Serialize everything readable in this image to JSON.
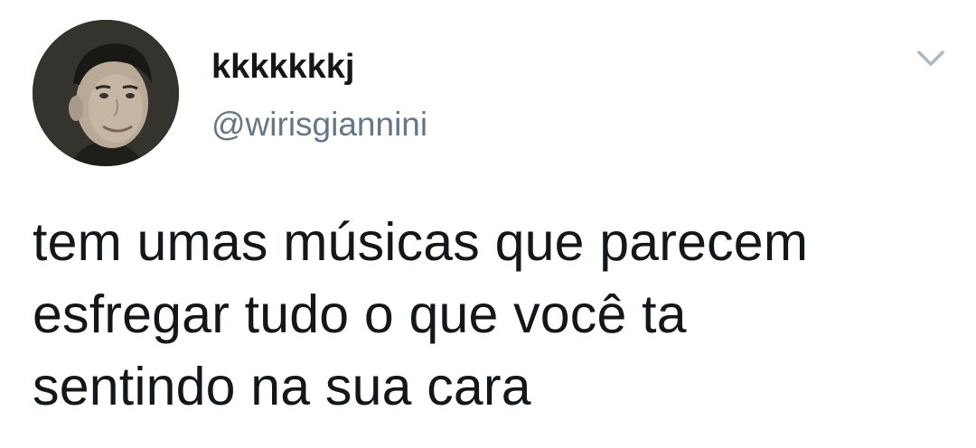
{
  "tweet": {
    "author": {
      "display_name": "kkkkkkkj",
      "handle": "@wirisgiannini",
      "avatar_icon": "profile-photo"
    },
    "menu_icon": "chevron-down-icon",
    "text_lines": [
      "tem umas músicas que parecem",
      "esfregar tudo o que você ta",
      "sentindo na sua cara"
    ]
  },
  "colors": {
    "text": "#14171a",
    "secondary_text": "#657786",
    "chevron": "#aab8c2",
    "background": "#ffffff"
  }
}
